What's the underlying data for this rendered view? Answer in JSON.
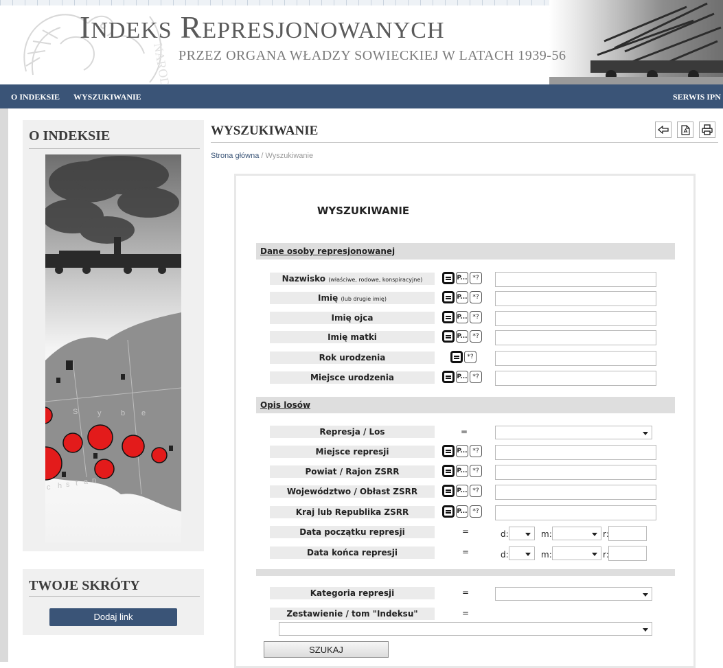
{
  "header": {
    "title_first_cap": "I",
    "title_first_rest": "NDEKS",
    "title_second_cap": "R",
    "title_second_rest": "EPRESJONOWANYCH",
    "subtitle": "PRZEZ ORGANA WŁADZY SOWIECKIEJ W LATACH 1939-56",
    "logo_text": "NARODOWEJ"
  },
  "nav": {
    "o_indeksie": "O INDEKSIE",
    "wyszukiwanie": "WYSZUKIWANIE",
    "serwis_ipn": "SERWIS IPN"
  },
  "sidebar": {
    "about_title": "O INDEKSIE",
    "map_words": [
      "S",
      "y",
      "b",
      "e",
      "c",
      "h",
      "s",
      "t",
      "a",
      "n"
    ],
    "shortcuts_title": "TWOJE SKRÓTY",
    "add_link": "Dodaj link"
  },
  "main": {
    "title": "WYSZUKIWANIE",
    "breadcrumb_home": "Strona główna",
    "breadcrumb_sep": " / ",
    "breadcrumb_current": "Wyszukiwanie",
    "tools": {
      "back_icon": "back-arrow-icon",
      "pdf_icon": "pdf-icon",
      "print_icon": "printer-icon"
    }
  },
  "form": {
    "title": "WYSZUKIWANIE",
    "section_person": "Dane osoby represjonowanej",
    "section_fate": "Opis losów",
    "mode_p_label": "P...",
    "mode_star_label": "*?",
    "person_fields": [
      {
        "label": "Nazwisko",
        "note": "(właściwe, rodowe, konspiracyjne)",
        "value": ""
      },
      {
        "label": "Imię",
        "note": "(lub drugie imię)",
        "value": ""
      },
      {
        "label": "Imię ojca",
        "note": "",
        "value": ""
      },
      {
        "label": "Imię matki",
        "note": "",
        "value": ""
      },
      {
        "label": "Rok urodzenia",
        "note": "",
        "value": ""
      },
      {
        "label": "Miejsce urodzenia",
        "note": "",
        "value": ""
      }
    ],
    "represja_label": "Represja / Los",
    "represja_value": "",
    "fate_fields": [
      {
        "label": "Miejsce represji",
        "value": ""
      },
      {
        "label": "Powiat / Rajon ZSRR",
        "value": ""
      },
      {
        "label": "Województwo / Obłast ZSRR",
        "value": ""
      },
      {
        "label": "Kraj lub Republika ZSRR",
        "value": ""
      }
    ],
    "date_start_label": "Data początku represji",
    "date_end_label": "Data końca represji",
    "eq": "=",
    "d_label": "d:",
    "m_label": "m:",
    "r_label": "r:",
    "kategoria_label": "Kategoria represji",
    "zestawienie_label": "Zestawienie / tom \"Indeksu\"",
    "search_button": "SZUKAJ"
  },
  "colors": {
    "nav_bg": "#3a5477",
    "section_bg": "#dedede",
    "map_red": "#e31b1b"
  }
}
